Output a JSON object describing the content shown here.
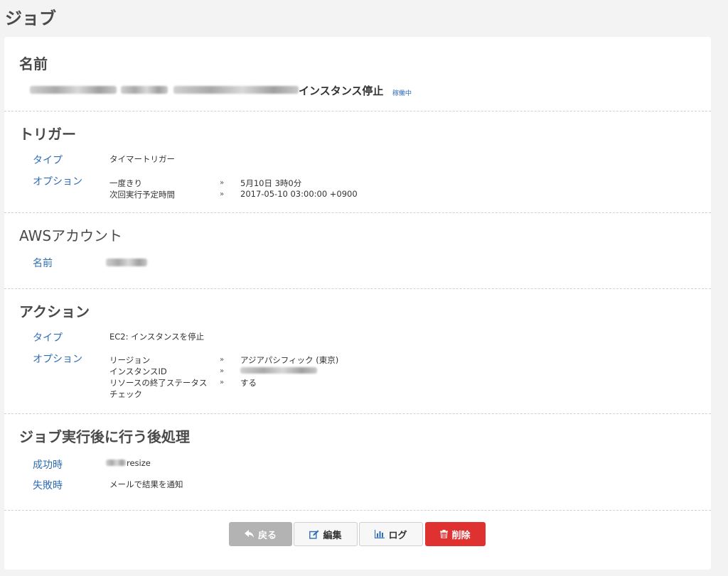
{
  "page": {
    "title": "ジョブ"
  },
  "name_section": {
    "heading": "名前",
    "job_name_suffix": "インスタンス停止",
    "status": "稼働中"
  },
  "trigger": {
    "heading": "トリガー",
    "type_label": "タイプ",
    "type_value": "タイマートリガー",
    "option_label": "オプション",
    "options": [
      {
        "name": "一度きり",
        "value": "5月10日 3時0分"
      },
      {
        "name": "次回実行予定時間",
        "value": "2017-05-10 03:00:00 +0900"
      }
    ]
  },
  "aws_account": {
    "heading": "AWSアカウント",
    "name_label": "名前"
  },
  "action": {
    "heading": "アクション",
    "type_label": "タイプ",
    "type_value": "EC2: インスタンスを停止",
    "option_label": "オプション",
    "options": [
      {
        "name": "リージョン",
        "value": "アジアパシフィック (東京)"
      },
      {
        "name": "インスタンスID",
        "value": ""
      },
      {
        "name": "リソースの終了ステータス",
        "name2": "チェック",
        "value": "する"
      }
    ]
  },
  "post_process": {
    "heading": "ジョブ実行後に行う後処理",
    "success_label": "成功時",
    "success_value": "resize",
    "failure_label": "失敗時",
    "failure_value": "メールで結果を通知"
  },
  "buttons": {
    "back": "戻る",
    "edit": "編集",
    "log": "ログ",
    "delete": "削除"
  },
  "separator_glyph": "»",
  "colors": {
    "link_blue": "#2f6db5",
    "delete_red": "#e03131",
    "back_gray": "#b3b3b3"
  }
}
